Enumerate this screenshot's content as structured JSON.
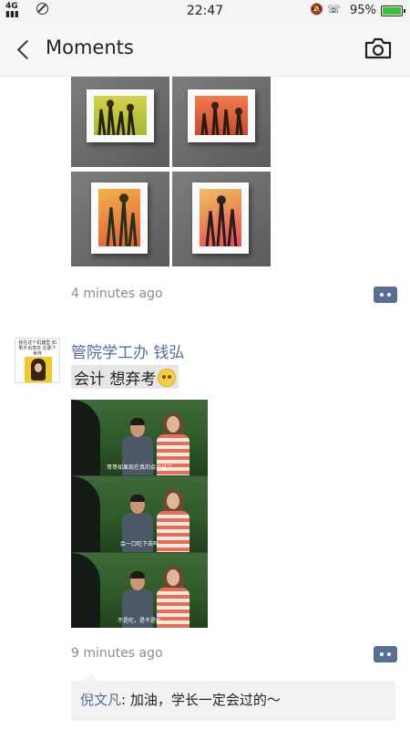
{
  "status_bar": {
    "signal_text": "4G 4G",
    "time": "22:47",
    "battery": "95%",
    "battery_level": 0.95
  },
  "nav": {
    "title": "Moments"
  },
  "post1": {
    "timestamp": "4 minutes ago"
  },
  "post2": {
    "author": "管院学工办 钱弘",
    "text": "会计 想弃考",
    "avatar_text": "我在这个机器里 如果不出意外 在那个世界",
    "subtitles": [
      "哥哥如果现在真的会计过了",
      "会一口吃下去吗",
      "不是吃，是不是吃"
    ],
    "timestamp": "9 minutes ago"
  },
  "comment": {
    "author": "倪文凡",
    "separator": ": ",
    "text": "加油，学长一定会过的～"
  },
  "colors": {
    "link": "#576b95",
    "comment_bg": "#f2f2f2",
    "timestamp": "#8c8c8c"
  }
}
